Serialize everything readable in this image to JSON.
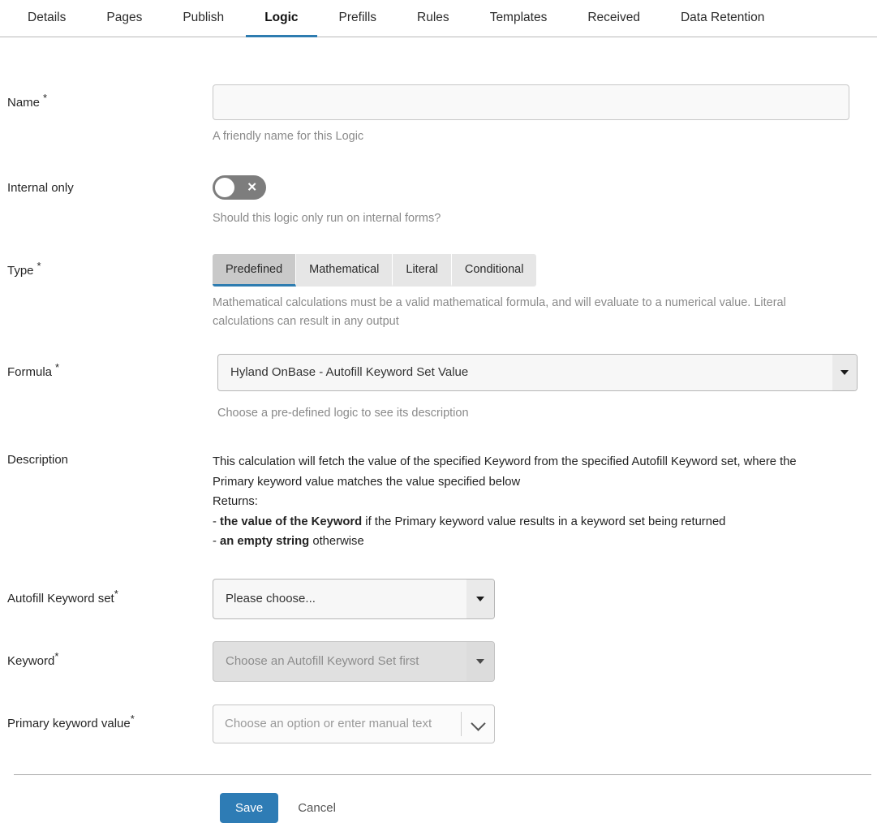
{
  "tabs": [
    {
      "label": "Details",
      "active": false
    },
    {
      "label": "Pages",
      "active": false
    },
    {
      "label": "Publish",
      "active": false
    },
    {
      "label": "Logic",
      "active": true
    },
    {
      "label": "Prefills",
      "active": false
    },
    {
      "label": "Rules",
      "active": false
    },
    {
      "label": "Templates",
      "active": false
    },
    {
      "label": "Received",
      "active": false
    },
    {
      "label": "Data Retention",
      "active": false
    }
  ],
  "colors": {
    "accent": "#2e7cb0",
    "save_button": "#2e7cb5",
    "toggle_off": "#7d7d7d",
    "segment_active": "#c9c9c9"
  },
  "fields": {
    "name": {
      "label": "Name",
      "required_mark": "*",
      "value": "",
      "placeholder": "",
      "help": "A friendly name for this Logic"
    },
    "internal_only": {
      "label": "Internal only",
      "state": "off",
      "mark": "✕",
      "help": "Should this logic only run on internal forms?"
    },
    "type": {
      "label": "Type",
      "required_mark": "*",
      "options": [
        "Predefined",
        "Mathematical",
        "Literal",
        "Conditional"
      ],
      "selected": "Predefined",
      "help": "Mathematical calculations must be a valid mathematical formula, and will evaluate to a numerical value. Literal calculations can result in any output"
    },
    "formula": {
      "label": "Formula",
      "required_mark": "*",
      "value": "Hyland OnBase - Autofill Keyword Set Value",
      "help": "Choose a pre-defined logic to see its description"
    },
    "description": {
      "label": "Description",
      "lines": [
        {
          "parts": [
            {
              "text": "This calculation will fetch the value of the specified Keyword from the specified Autofill Keyword set, where the Primary keyword value matches the value specified below",
              "bold": false
            }
          ]
        },
        {
          "parts": [
            {
              "text": "Returns:",
              "bold": false
            }
          ]
        },
        {
          "parts": [
            {
              "text": "- ",
              "bold": false
            },
            {
              "text": "the value of the Keyword",
              "bold": true
            },
            {
              "text": " if the Primary keyword value results in a keyword set being returned",
              "bold": false
            }
          ]
        },
        {
          "parts": [
            {
              "text": "- ",
              "bold": false
            },
            {
              "text": "an empty string",
              "bold": true
            },
            {
              "text": " otherwise",
              "bold": false
            }
          ]
        }
      ]
    },
    "autofill_keyword_set": {
      "label": "Autofill Keyword set",
      "required_mark": "*",
      "value": "Please choose...",
      "disabled": false
    },
    "keyword": {
      "label": "Keyword",
      "required_mark": "*",
      "value": "Choose an Autofill Keyword Set first",
      "disabled": true
    },
    "primary_keyword_value": {
      "label": "Primary keyword value",
      "required_mark": "*",
      "value": "",
      "placeholder": "Choose an option or enter manual text"
    }
  },
  "footer": {
    "save_label": "Save",
    "cancel_label": "Cancel"
  }
}
